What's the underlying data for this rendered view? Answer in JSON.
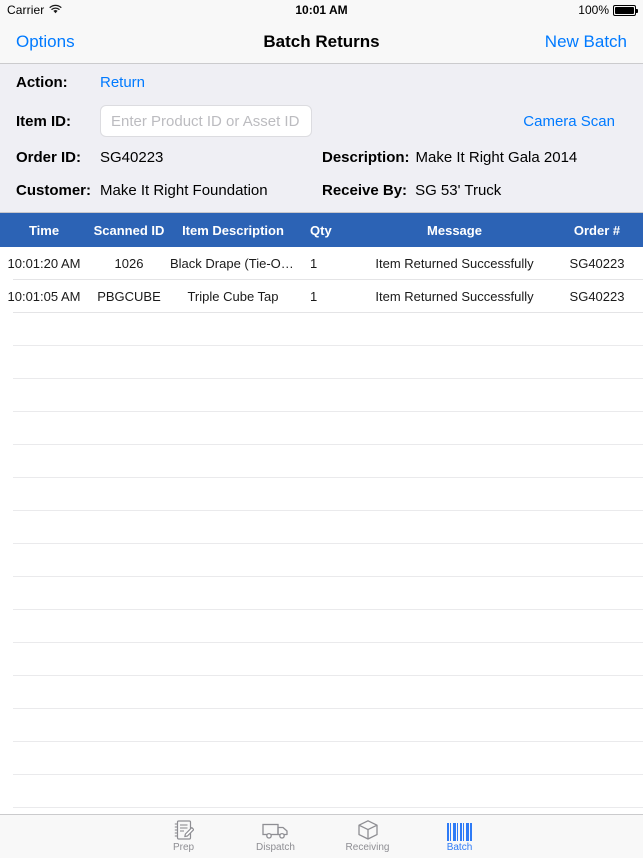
{
  "status_bar": {
    "carrier": "Carrier",
    "wifi_icon": "wifi-icon",
    "time": "10:01 AM",
    "battery_percent": "100%",
    "battery_icon": "battery-full-icon"
  },
  "nav_bar": {
    "left_button": "Options",
    "title": "Batch Returns",
    "right_button": "New Batch"
  },
  "form": {
    "action_label": "Action:",
    "action_value": "Return",
    "item_id_label": "Item ID:",
    "item_id_value": "",
    "item_id_placeholder": "Enter Product ID or Asset ID",
    "camera_scan_label": "Camera Scan",
    "order_id_label": "Order ID:",
    "order_id_value": "SG40223",
    "description_label": "Description:",
    "description_value": "Make It Right Gala 2014",
    "customer_label": "Customer:",
    "customer_value": "Make It Right Foundation",
    "receive_by_label": "Receive By:",
    "receive_by_value": "SG 53' Truck"
  },
  "table": {
    "header_color": "#2c63b5",
    "columns": [
      "Time",
      "Scanned ID",
      "Item Description",
      "Qty",
      "Message",
      "Order #"
    ],
    "rows": [
      {
        "time": "10:01:20 AM",
        "scanned_id": "1026",
        "item_description": "Black Drape (Tie-On) -…",
        "qty": "1",
        "message": "Item Returned Successfully",
        "order": "SG40223"
      },
      {
        "time": "10:01:05 AM",
        "scanned_id": "PBGCUBE",
        "item_description": "Triple Cube Tap",
        "qty": "1",
        "message": "Item Returned Successfully",
        "order": "SG40223"
      }
    ],
    "empty_row_count": 15
  },
  "tab_bar": {
    "accent_color": "#2e7bf6",
    "inactive_color": "#8e8e93",
    "tabs": [
      {
        "label": "Prep",
        "icon": "notepad-pencil-icon",
        "active": false
      },
      {
        "label": "Dispatch",
        "icon": "truck-icon",
        "active": false
      },
      {
        "label": "Receiving",
        "icon": "box-icon",
        "active": false
      },
      {
        "label": "Batch",
        "icon": "barcode-icon",
        "active": true
      }
    ]
  }
}
